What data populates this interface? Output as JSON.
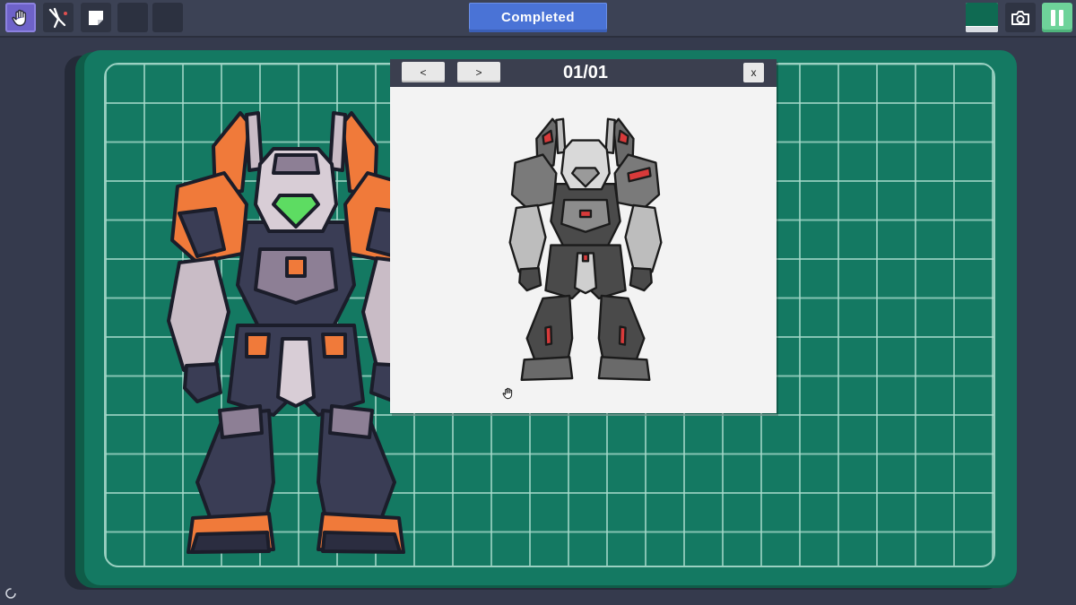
{
  "toolbar": {
    "tools": [
      {
        "name": "hand-tool",
        "icon": "hand-icon",
        "active": true
      },
      {
        "name": "cutter-tool",
        "icon": "nippers-icon",
        "active": false
      },
      {
        "name": "sticker-tool",
        "icon": "sticker-icon",
        "active": false
      },
      {
        "name": "empty-slot-1",
        "icon": "",
        "active": false
      },
      {
        "name": "empty-slot-2",
        "icon": "",
        "active": false
      }
    ],
    "status_label": "Completed",
    "color_swatch": "#0f6a52",
    "camera_icon": "camera-icon",
    "pause_icon": "pause-icon"
  },
  "reference": {
    "prev_label": "<",
    "next_label": ">",
    "page_indicator": "01/01",
    "close_label": "x"
  },
  "colors": {
    "mat": "#147962",
    "accent_orange": "#f07a3a",
    "status_blue": "#4a73d6",
    "pause_green": "#6ed39a"
  }
}
